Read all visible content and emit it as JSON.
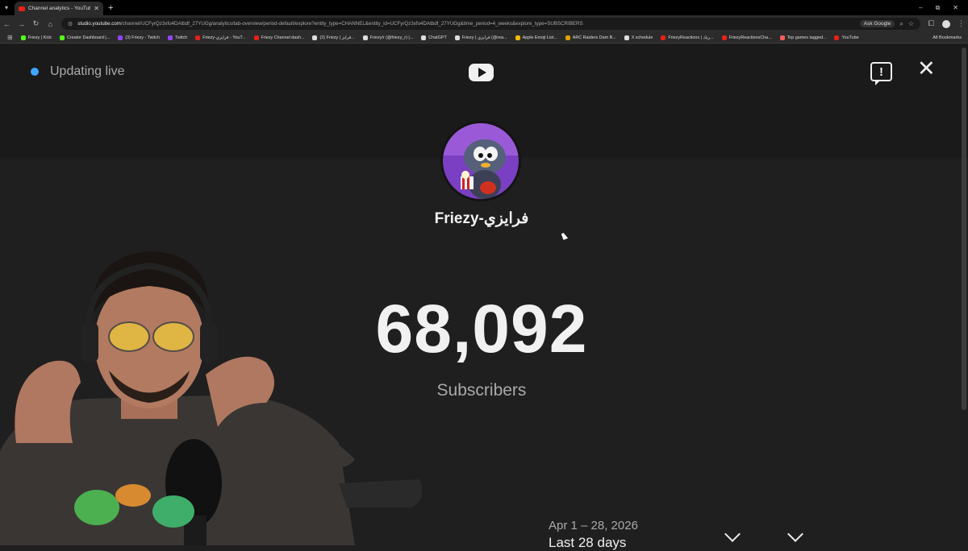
{
  "browser": {
    "tab_title": "Channel analytics - YouTube St",
    "url_domain": "studio.youtube.com",
    "url_path": "/channel/UCFyrQz3xfo4DAtbdf_27YUGg/analytics/tab-overview/period-default/explore?entity_type=CHANNEL&entity_id=UCFyrQz3xfo4DAtbdf_27YUGg&time_period=4_weeks&explore_type=SUBSCRIBERS",
    "ask_google": "Ask Google",
    "bookmarks": [
      {
        "label": "Friezy | Kick",
        "color": "#53fc18"
      },
      {
        "label": "Creator Dashboard |...",
        "color": "#53fc18"
      },
      {
        "label": "(3) Friezy - Twitch",
        "color": "#9146ff"
      },
      {
        "label": "Twitch",
        "color": "#9146ff"
      },
      {
        "label": "Friezy-فرايزي - YouT...",
        "color": "#e62117"
      },
      {
        "label": "Friezy Channel dash...",
        "color": "#e62117"
      },
      {
        "label": "(2) Friezy | فرايز...",
        "color": "#dddddd"
      },
      {
        "label": "Friezy/r (@friezy_r) |...",
        "color": "#dddddd"
      },
      {
        "label": "ChatGPT",
        "color": "#dddddd"
      },
      {
        "label": "Friezy | فرايزي (@rea...",
        "color": "#dddddd"
      },
      {
        "label": "Apple Emoji List...",
        "color": "#f5b700"
      },
      {
        "label": "ARC Raiders Dam B...",
        "color": "#e0a000"
      },
      {
        "label": "X schedule",
        "color": "#dddddd"
      },
      {
        "label": "FriezyReactions | ريك...",
        "color": "#e62117"
      },
      {
        "label": "FriezyReactionsCha...",
        "color": "#e62117"
      },
      {
        "label": "Top games tagged...",
        "color": "#fa5c5c"
      },
      {
        "label": "YouTube",
        "color": "#e62117"
      }
    ],
    "all_bookmarks": "All Bookmarks"
  },
  "studio": {
    "live_label": "Updating live",
    "channel_name": "Friezy-فرايزي",
    "subscriber_count": "68,092",
    "subscriber_label": "Subscribers",
    "period_date": "Apr 1 – 28, 2026",
    "period_name": "Last 28 days"
  },
  "colors": {
    "live_dot": "#3ea6ff",
    "background": "#1f1f1f",
    "header_background": "#1a1a1a"
  }
}
